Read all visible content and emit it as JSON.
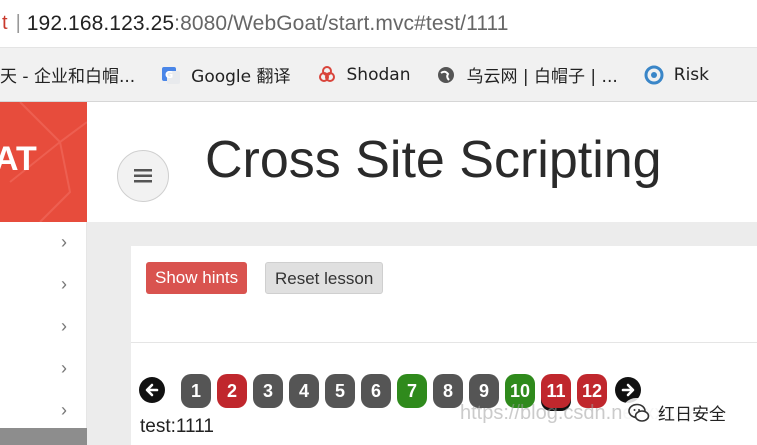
{
  "browser": {
    "address_prefix": "t",
    "url_host": "192.168.123.25",
    "url_rest": ":8080/WebGoat/start.mvc#test/1111"
  },
  "bookmarks": [
    {
      "label": "天 - 企业和白帽...",
      "icon": "bookmark-icon"
    },
    {
      "label": "Google 翻译",
      "icon": "google-translate-icon"
    },
    {
      "label": "Shodan",
      "icon": "shodan-icon"
    },
    {
      "label": "乌云网 | 白帽子 | ...",
      "icon": "globe-icon"
    },
    {
      "label": "Risk",
      "icon": "risk-icon"
    }
  ],
  "app": {
    "logo_text": "AT",
    "title": "Cross Site Scripting",
    "menu_icon": "hamburger-icon"
  },
  "lesson": {
    "show_hints": "Show hints",
    "reset_lesson": "Reset lesson",
    "pages": [
      {
        "label": "1",
        "state": "gray"
      },
      {
        "label": "2",
        "state": "red"
      },
      {
        "label": "3",
        "state": "gray"
      },
      {
        "label": "4",
        "state": "gray"
      },
      {
        "label": "5",
        "state": "gray"
      },
      {
        "label": "6",
        "state": "gray"
      },
      {
        "label": "7",
        "state": "green"
      },
      {
        "label": "8",
        "state": "gray"
      },
      {
        "label": "9",
        "state": "gray"
      },
      {
        "label": "10",
        "state": "green"
      },
      {
        "label": "11",
        "state": "red"
      },
      {
        "label": "12",
        "state": "red"
      }
    ],
    "current_page": "11",
    "output_text": "test:1111"
  },
  "watermark": {
    "url": "https://blog.csdn.net/xxxxx",
    "badge": "红日安全"
  },
  "colors": {
    "accent_red": "#e74c3c",
    "hint_red": "#d9534f",
    "page_red": "#c0272d",
    "page_green": "#2f8a1c",
    "page_gray": "#555555"
  }
}
